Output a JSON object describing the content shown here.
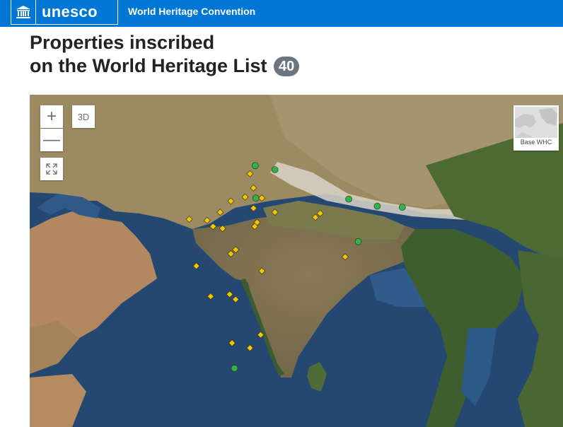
{
  "header": {
    "logo_text": "unesco",
    "site_title": "World Heritage Convention"
  },
  "page": {
    "title_line1": "Properties inscribed",
    "title_line2": "on the World Heritage List",
    "count": "40"
  },
  "map": {
    "controls": {
      "zoom_in": "+",
      "zoom_out": "—",
      "three_d": "3D",
      "basemap_label": "Base WHC"
    },
    "marker_colors": {
      "cultural": "#f2c500",
      "natural": "#2fb34a"
    },
    "markers": [
      {
        "type": "natural",
        "lon": 77.95,
        "lat": 30.8
      },
      {
        "type": "natural",
        "lon": 79.6,
        "lat": 30.4
      },
      {
        "type": "cultural",
        "lon": 77.5,
        "lat": 30.0
      },
      {
        "type": "cultural",
        "lon": 77.8,
        "lat": 28.6
      },
      {
        "type": "cultural",
        "lon": 77.1,
        "lat": 27.7
      },
      {
        "type": "natural",
        "lon": 78.0,
        "lat": 27.6
      },
      {
        "type": "cultural",
        "lon": 78.5,
        "lat": 27.6
      },
      {
        "type": "cultural",
        "lon": 75.9,
        "lat": 27.3
      },
      {
        "type": "cultural",
        "lon": 77.8,
        "lat": 26.6
      },
      {
        "type": "cultural",
        "lon": 75.0,
        "lat": 26.2
      },
      {
        "type": "cultural",
        "lon": 79.6,
        "lat": 26.2
      },
      {
        "type": "cultural",
        "lon": 72.4,
        "lat": 25.5
      },
      {
        "type": "cultural",
        "lon": 73.9,
        "lat": 25.4
      },
      {
        "type": "cultural",
        "lon": 74.4,
        "lat": 24.8
      },
      {
        "type": "cultural",
        "lon": 75.2,
        "lat": 24.6
      },
      {
        "type": "cultural",
        "lon": 78.1,
        "lat": 25.2
      },
      {
        "type": "cultural",
        "lon": 77.9,
        "lat": 24.8
      },
      {
        "type": "cultural",
        "lon": 83.0,
        "lat": 25.7
      },
      {
        "type": "cultural",
        "lon": 83.4,
        "lat": 26.1
      },
      {
        "type": "natural",
        "lon": 85.8,
        "lat": 27.5
      },
      {
        "type": "natural",
        "lon": 88.2,
        "lat": 26.8
      },
      {
        "type": "natural",
        "lon": 90.3,
        "lat": 26.7
      },
      {
        "type": "natural",
        "lon": 86.6,
        "lat": 23.3
      },
      {
        "type": "cultural",
        "lon": 85.5,
        "lat": 21.8
      },
      {
        "type": "cultural",
        "lon": 76.3,
        "lat": 22.5
      },
      {
        "type": "cultural",
        "lon": 75.9,
        "lat": 22.1
      },
      {
        "type": "cultural",
        "lon": 73.0,
        "lat": 20.9
      },
      {
        "type": "cultural",
        "lon": 78.5,
        "lat": 20.4
      },
      {
        "type": "cultural",
        "lon": 74.2,
        "lat": 17.9
      },
      {
        "type": "cultural",
        "lon": 75.8,
        "lat": 18.1
      },
      {
        "type": "cultural",
        "lon": 76.3,
        "lat": 17.6
      },
      {
        "type": "cultural",
        "lon": 78.4,
        "lat": 14.1
      },
      {
        "type": "cultural",
        "lon": 76.0,
        "lat": 13.3
      },
      {
        "type": "cultural",
        "lon": 77.5,
        "lat": 12.8
      },
      {
        "type": "natural",
        "lon": 76.2,
        "lat": 10.8
      }
    ]
  }
}
